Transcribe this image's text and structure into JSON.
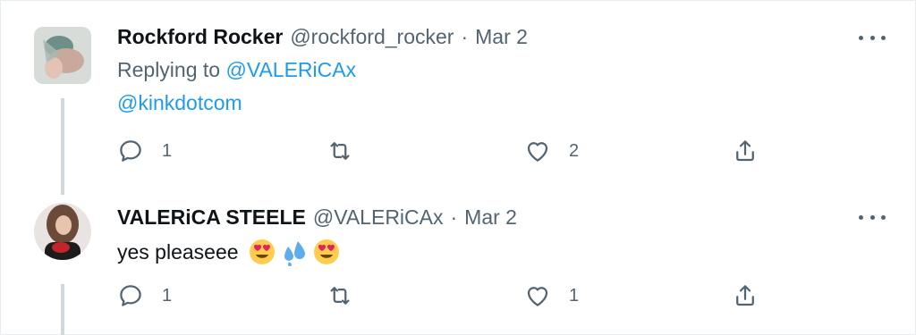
{
  "tweets": [
    {
      "author_name": "Rockford Rocker",
      "handle": "@rockford_rocker",
      "date": "Mar 2",
      "separator": "·",
      "replying_prefix": "Replying to",
      "replying_to": "@VALERiCAx",
      "text": "@kinkdotcom",
      "reply_count": "1",
      "retweet_count": "",
      "like_count": "2"
    },
    {
      "author_name": "VALERiCA STEELE",
      "handle": "@VALERiCAx",
      "date": "Mar 2",
      "separator": "·",
      "text": "yes pleaseee",
      "emojis": [
        "heart-eyes-emoji",
        "sweat-droplets-emoji",
        "heart-eyes-emoji"
      ],
      "reply_count": "1",
      "retweet_count": "",
      "like_count": "1"
    }
  ],
  "colors": {
    "link": "#1d9bf0",
    "secondary_text": "#536471",
    "thread_line": "#cfd9de"
  },
  "icons": [
    "reply-icon",
    "retweet-icon",
    "like-icon",
    "share-icon",
    "more-icon"
  ]
}
